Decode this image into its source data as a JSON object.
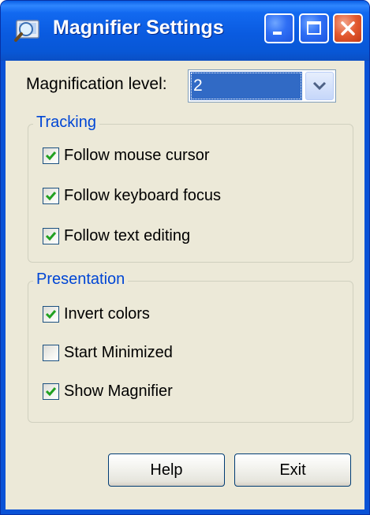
{
  "window": {
    "title": "Magnifier Settings",
    "title_color": "#ffffff",
    "titlebar_color": "#0a5be0"
  },
  "titlebar_buttons": [
    {
      "name": "minimize",
      "icon": "minimize-icon"
    },
    {
      "name": "maximize",
      "icon": "maximize-icon"
    },
    {
      "name": "close",
      "icon": "close-icon"
    }
  ],
  "magnification": {
    "label": "Magnification level:",
    "value": "2",
    "icon": "chevron-down-icon"
  },
  "tracking": {
    "legend": "Tracking",
    "items": [
      {
        "label": "Follow mouse cursor",
        "checked": true
      },
      {
        "label": "Follow keyboard focus",
        "checked": true
      },
      {
        "label": "Follow text editing",
        "checked": true
      }
    ]
  },
  "presentation": {
    "legend": "Presentation",
    "items": [
      {
        "label": "Invert colors",
        "checked": true
      },
      {
        "label": "Start Minimized",
        "checked": false
      },
      {
        "label": "Show Magnifier",
        "checked": true
      }
    ]
  },
  "buttons": {
    "help": "Help",
    "exit": "Exit"
  },
  "colors": {
    "client_bg": "#ece9d8",
    "groupbox_legend": "#0046d5",
    "check_mark": "#21a121",
    "selection": "#316ac5"
  }
}
